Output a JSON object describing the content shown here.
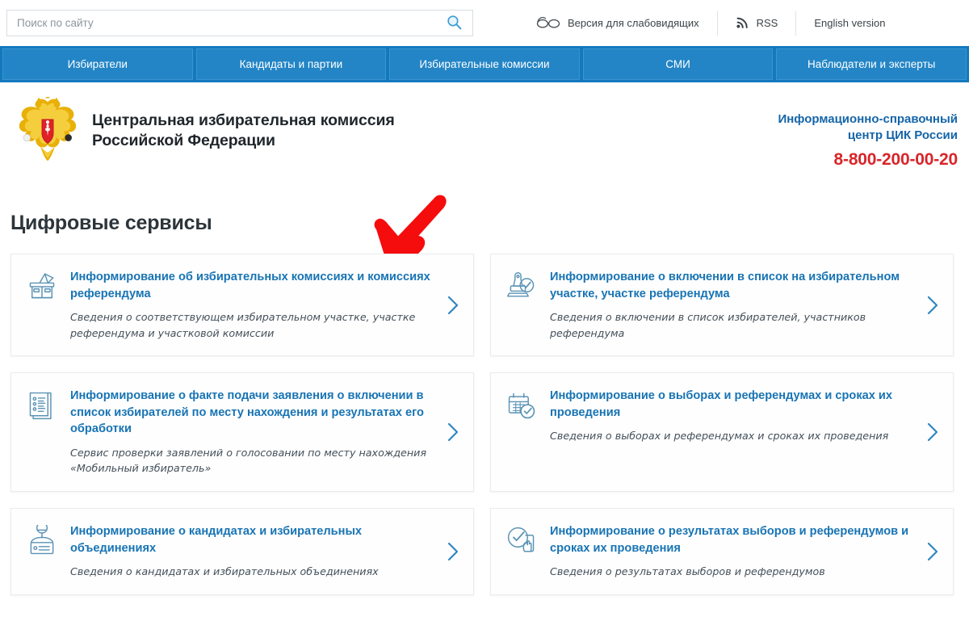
{
  "search": {
    "placeholder": "Поиск по сайту",
    "value": "",
    "icon": "search-icon"
  },
  "utility": {
    "accessibility": {
      "label": "Версия для слабовидящих",
      "icon": "glasses-icon"
    },
    "rss": {
      "label": "RSS",
      "icon": "rss-icon"
    },
    "english": {
      "label": "English version"
    }
  },
  "nav": {
    "items": [
      {
        "label": "Избиратели"
      },
      {
        "label": "Кандидаты и партии"
      },
      {
        "label": "Избирательные комиссии"
      },
      {
        "label": "СМИ"
      },
      {
        "label": "Наблюдатели и эксперты"
      }
    ]
  },
  "brand": {
    "emblem_icon": "russian-coat-of-arms-icon",
    "title_line1": "Центральная избирательная комиссия",
    "title_line2": "Российской Федерации",
    "info_center_line1": "Информационно-справочный",
    "info_center_line2": "центр ЦИК России",
    "phone": "8-800-200-00-20"
  },
  "section": {
    "title": "Цифровые сервисы",
    "annotation_icon": "red-arrow-annotation"
  },
  "services": [
    {
      "icon": "ballot-box-icon",
      "title": "Информирование об избирательных комиссиях и комиссиях референдума",
      "desc": "Сведения о соответствующем избирательном участке, участке референдума и участковой комиссии",
      "chevron": "chevron-right-icon"
    },
    {
      "icon": "stamp-check-icon",
      "title": "Информирование о включении в список на избирательном участке, участке референдума",
      "desc": "Сведения о включении в список избирателей, участников референдума",
      "chevron": "chevron-right-icon"
    },
    {
      "icon": "document-list-icon",
      "title": "Информирование о факте подачи заявления о включении в список избирателей по месту нахождения и результатах его обработки",
      "desc": "Сервис проверки заявлений о голосовании по месту нахождения «Мобильный избиратель»",
      "chevron": "chevron-right-icon"
    },
    {
      "icon": "calendar-check-icon",
      "title": "Информирование о выборах и референдумах и сроках их проведения",
      "desc": "Сведения о выборах и референдумах и сроках их проведения",
      "chevron": "chevron-right-icon"
    },
    {
      "icon": "candidate-person-icon",
      "title": "Информирование о кандидатах и избирательных объединениях",
      "desc": "Сведения о кандидатах и избирательных объединениях",
      "chevron": "chevron-right-icon"
    },
    {
      "icon": "hand-check-icon",
      "title": "Информирование о результатах выборов и референдумов и сроках их проведения",
      "desc": "Сведения о результатах выборов и референдумов",
      "chevron": "chevron-right-icon"
    }
  ],
  "colors": {
    "nav_bar": "#1379bd",
    "nav_button": "#2385c6",
    "link_blue": "#1874b4",
    "info_blue": "#1565a8",
    "phone_red": "#d9252a",
    "annotation_red": "#f50c0c",
    "heading_dark": "#2d353b",
    "icon_stroke": "#5b93b5"
  }
}
